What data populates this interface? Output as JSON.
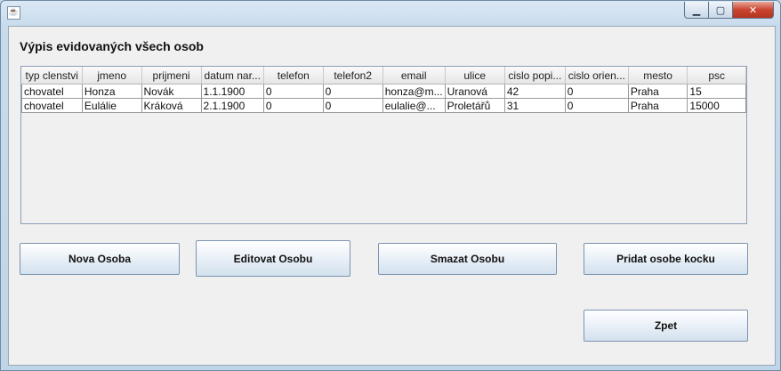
{
  "window": {
    "minimize": "▁",
    "maximize": "▢",
    "close": "✕"
  },
  "heading": "Výpis evidovaných všech osob",
  "table": {
    "columns": [
      "typ clenstvi",
      "jmeno",
      "prijmeni",
      "datum nar...",
      "telefon",
      "telefon2",
      "email",
      "ulice",
      "cislo popi...",
      "cislo orien...",
      "mesto",
      "psc"
    ],
    "rows": [
      [
        "chovatel",
        "Honza",
        "Novák",
        "1.1.1900",
        "0",
        "0",
        "honza@m...",
        "Uranová",
        "42",
        "0",
        "Praha",
        "15"
      ],
      [
        "chovatel",
        "Eulálie",
        "Kráková",
        "2.1.1900",
        "0",
        "0",
        "eulalie@...",
        "Proletářů",
        "31",
        "0",
        "Praha",
        "15000"
      ]
    ]
  },
  "buttons": {
    "new": "Nova Osoba",
    "edit": "Editovat Osobu",
    "delete": "Smazat Osobu",
    "add_cat": "Pridat osobe kocku",
    "back": "Zpet"
  }
}
